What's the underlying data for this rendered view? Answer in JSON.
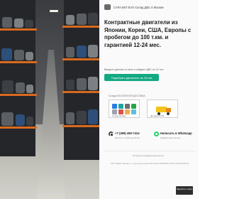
{
  "header": {
    "company_name": "CAR-UNIT.EVS Склад ДВС в Москве"
  },
  "hero": {
    "headline": "Контрактные двигатели из Японии, Кореи, США, Европы с пробегом до 100 т.км. и гарантией 12-24 мес.",
    "subtext": "Введите данные по авто и найдите ДВС из 42 тыс",
    "cta_label": "Подобрать двигатель за 15 сек"
  },
  "partners": {
    "label": "Склады БЕСПЛАТНАЯ ДОСТАВКА",
    "left_card_caption": "Склады Москвы",
    "right_card_caption": "Доставка по РФ"
  },
  "contacts": {
    "phone": "+7 (499) 490-7414",
    "phone_sub": "Звонить с 09:00 до 21:00",
    "whatsapp_label": "Написать в Whatsapp",
    "whatsapp_sub": "Задайте ваш вопрос"
  },
  "footer": {
    "privacy_link": "Политика конфиденциальности",
    "legal_text": "ООО \"ВЕЗИ\" Москва ул. Судостроительная 18Р ИНН 1234567890 ОГРН 1234567890123"
  },
  "badge": {
    "text": "Перейти к сайту"
  },
  "colors": {
    "accent": "#12a982",
    "whatsapp": "#25d366",
    "shelf_beam": "#d86a1e"
  }
}
